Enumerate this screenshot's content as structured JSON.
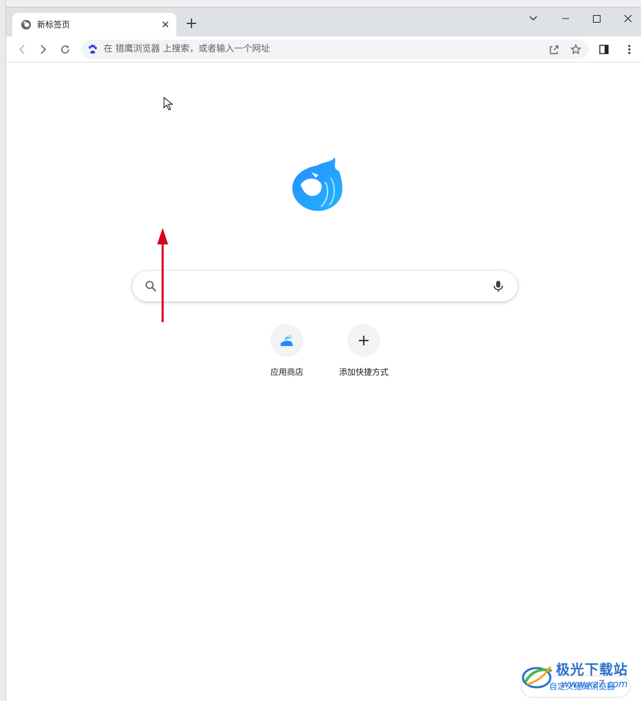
{
  "browser": {
    "tab": {
      "title": "新标签页",
      "close_glyph": "✕"
    },
    "new_tab_glyph": "+",
    "window_controls": [
      "tab-search",
      "minimize",
      "maximize",
      "close"
    ]
  },
  "toolbar": {
    "omnibox_placeholder": "在 猎鹰浏览器 上搜索，或者输入一个网址",
    "search_engine_icon": "baidu-paw-icon"
  },
  "new_tab_page": {
    "search_placeholder": "",
    "shortcuts": [
      {
        "label": "应用商店",
        "icon": "app-store-icon"
      },
      {
        "label": "添加快捷方式",
        "icon": "plus-icon"
      }
    ],
    "customize_label": "自定义猎鹰浏览器"
  },
  "watermark": {
    "title": "极光下载站",
    "url": "www.xz7.com"
  },
  "colors": {
    "tab_strip": "#dee1e6",
    "accent_blue": "#1a8cff",
    "annotation_red": "#d9001b"
  }
}
